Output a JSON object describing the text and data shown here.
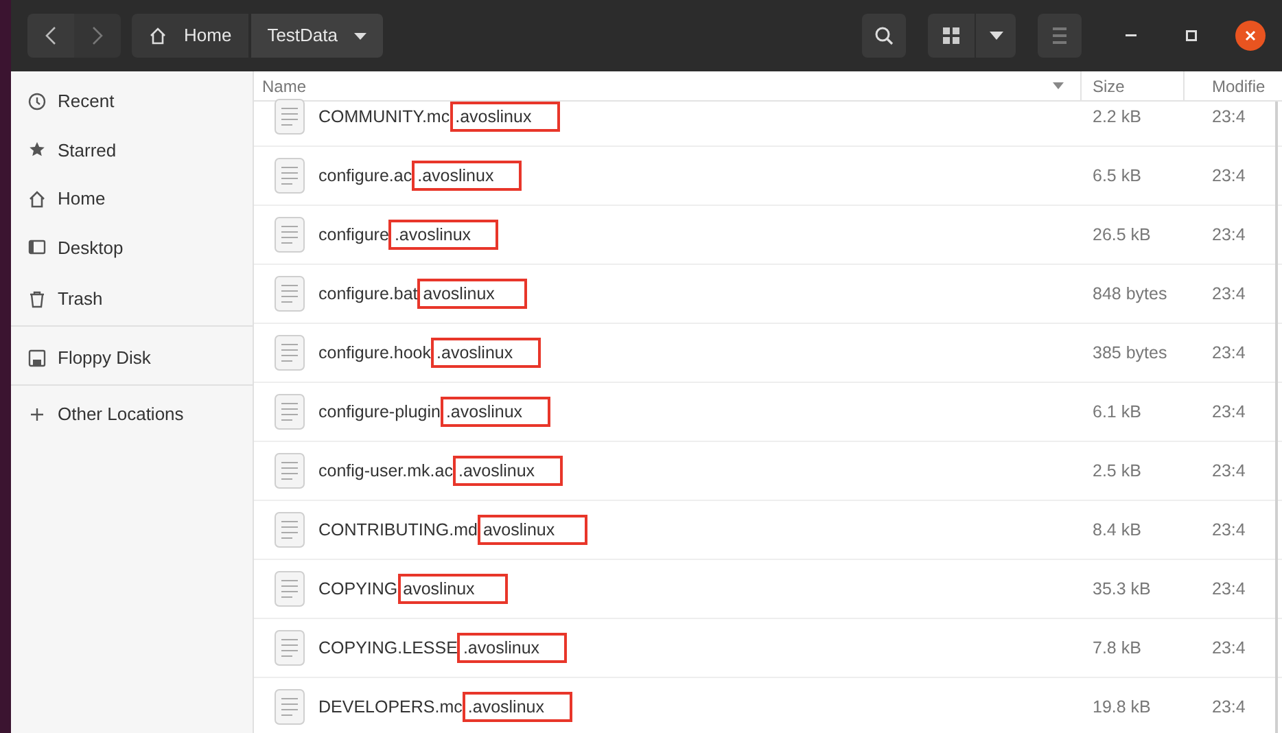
{
  "header_bar": {
    "path": [
      {
        "kind": "home",
        "label": "Home",
        "selected": false
      },
      {
        "kind": "folder",
        "label": "TestData",
        "selected": true
      }
    ]
  },
  "sidebar": {
    "items": [
      {
        "kind": "recent",
        "label": "Recent"
      },
      {
        "kind": "starred",
        "label": "Starred"
      },
      {
        "kind": "home",
        "label": "Home"
      },
      {
        "kind": "desktop",
        "label": "Desktop"
      },
      {
        "kind": "trash",
        "label": "Trash",
        "divider_after": true
      },
      {
        "kind": "floppy",
        "label": "Floppy Disk",
        "divider_after": true
      },
      {
        "kind": "other",
        "label": "Other Locations"
      }
    ]
  },
  "table": {
    "columns": [
      "Name",
      "Size",
      "Modifie"
    ],
    "rows": [
      {
        "name": "COMMUNITY.mc",
        "highlight": ".avoslinux",
        "size": "2.2 kB",
        "modified": "23:4"
      },
      {
        "name": "configure.ac",
        "highlight": ".avoslinux",
        "size": "6.5 kB",
        "modified": "23:4"
      },
      {
        "name": "configure",
        "highlight": ".avoslinux",
        "size": "26.5 kB",
        "modified": "23:4"
      },
      {
        "name": "configure.bat",
        "highlight": "avoslinux",
        "size": "848 bytes",
        "modified": "23:4"
      },
      {
        "name": "configure.hook",
        "highlight": ".avoslinux",
        "size": "385 bytes",
        "modified": "23:4"
      },
      {
        "name": "configure-plugin",
        "highlight": ".avoslinux",
        "size": "6.1 kB",
        "modified": "23:4"
      },
      {
        "name": "config-user.mk.ac",
        "highlight": ".avoslinux",
        "size": "2.5 kB",
        "modified": "23:4"
      },
      {
        "name": "CONTRIBUTING.md",
        "highlight": "avoslinux",
        "size": "8.4 kB",
        "modified": "23:4"
      },
      {
        "name": "COPYING",
        "highlight": "avoslinux",
        "size": "35.3 kB",
        "modified": "23:4"
      },
      {
        "name": "COPYING.LESSE",
        "highlight": ".avoslinux",
        "size": "7.8 kB",
        "modified": "23:4"
      },
      {
        "name": "DEVELOPERS.mc",
        "highlight": ".avoslinux",
        "size": "19.8 kB",
        "modified": "23:4"
      }
    ]
  }
}
